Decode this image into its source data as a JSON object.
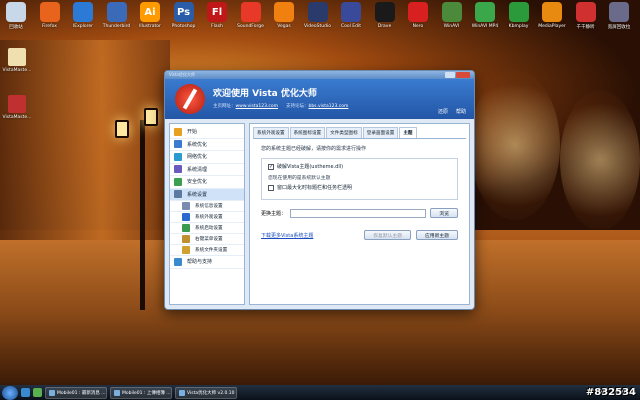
{
  "desktop": {
    "top_icons": [
      {
        "label": "回收站",
        "color": "#c8d8e8"
      },
      {
        "label": "Firefox",
        "color": "#e8641c"
      },
      {
        "label": "IExplorer",
        "color": "#2a7ad6"
      },
      {
        "label": "Thunderbird",
        "color": "#3a6ab8"
      },
      {
        "label": "Illustrator",
        "color": "#ff9a00",
        "glyph": "Ai"
      },
      {
        "label": "Photoshop",
        "color": "#2a5ca8",
        "glyph": "Ps"
      },
      {
        "label": "Flash",
        "color": "#c01818",
        "glyph": "Fl"
      },
      {
        "label": "SoundForge",
        "color": "#e83828"
      },
      {
        "label": "Vegas",
        "color": "#f08010"
      },
      {
        "label": "VideoStudio",
        "color": "#2a3a6a"
      },
      {
        "label": "Cool Edit",
        "color": "#3a4a9a"
      },
      {
        "label": "Drave",
        "color": "#1a1a1a"
      },
      {
        "label": "Nero",
        "color": "#d82020"
      },
      {
        "label": "WinAVI",
        "color": "#4a8a3a"
      },
      {
        "label": "WinAVI MP4",
        "color": "#3aa84a"
      },
      {
        "label": "Kbmplay",
        "color": "#2a9a3a"
      },
      {
        "label": "MediaPlayer",
        "color": "#e88a10"
      },
      {
        "label": "千千静听",
        "color": "#d03030"
      },
      {
        "label": "宽屏回收拉",
        "color": "#6a6a8a"
      }
    ],
    "side_icons": [
      {
        "label": "VistaMaste...",
        "color": "#f0e0b0"
      },
      {
        "label": "VistaMaste...",
        "color": "#c03030"
      }
    ]
  },
  "window": {
    "title": "Vista优化大师",
    "banner_headline": "欢迎使用 Vista 优化大师",
    "home_label": "主页网址：",
    "home_url": "www.vista123.com",
    "forum_label": "支持论坛：",
    "forum_url": "bbs.vista123.com",
    "tools": {
      "recovery": "还原",
      "help": "帮助"
    },
    "sidebar": [
      {
        "label": "开始",
        "color": "#e8a020",
        "sub": false,
        "selected": false
      },
      {
        "label": "系统优化",
        "color": "#3a7ad0",
        "sub": false,
        "selected": false
      },
      {
        "label": "网络优化",
        "color": "#2a9ad0",
        "sub": false,
        "selected": false
      },
      {
        "label": "系统清理",
        "color": "#6a5ac0",
        "sub": false,
        "selected": false
      },
      {
        "label": "安全优化",
        "color": "#3aa050",
        "sub": false,
        "selected": false
      },
      {
        "label": "系统设置",
        "color": "#5a7aa0",
        "sub": false,
        "selected": true
      },
      {
        "label": "系统信息设置",
        "color": "#7a8ab0",
        "sub": true,
        "selected": false
      },
      {
        "label": "系统外观设置",
        "color": "#2a6ad0",
        "sub": true,
        "selected": false
      },
      {
        "label": "系统启动设置",
        "color": "#3a9a50",
        "sub": true,
        "selected": false
      },
      {
        "label": "右键菜单设置",
        "color": "#c09030",
        "sub": true,
        "selected": false
      },
      {
        "label": "系统文件夹设置",
        "color": "#d0a030",
        "sub": true,
        "selected": false
      },
      {
        "label": "帮助与支持",
        "color": "#3a8ad0",
        "sub": false,
        "selected": false
      }
    ],
    "tabs": [
      {
        "label": "系统外观设置",
        "active": false
      },
      {
        "label": "系统图标设置",
        "active": false
      },
      {
        "label": "文件类型图标",
        "active": false
      },
      {
        "label": "登录画面设置",
        "active": false
      },
      {
        "label": "主题",
        "active": true
      }
    ],
    "panel": {
      "description": "您的系统主题已经破解，请按你的需求进行操作",
      "crack_checkbox": "破解Vista主题(uxtheme.dll)",
      "crack_checked": "✓",
      "note": "您现在使用的是系统默认主题",
      "taskbar_checkbox": "窗口最大化时标题栏和任务栏透明",
      "theme_label": "更换主题：",
      "theme_value": "",
      "browse_button": "浏览",
      "download_link": "下载更多Vista系统主题",
      "restore_button": "恢复默认主题",
      "apply_button": "应用新主题"
    }
  },
  "taskbar": {
    "buttons": [
      "Mobile01 : 最新消息 ...",
      "Mobile01 : 上傳相簿 ...",
      "Vista优化大师 v2.0.10"
    ],
    "lang": "EN",
    "time": "下午 06:42"
  },
  "watermark": "#832534"
}
